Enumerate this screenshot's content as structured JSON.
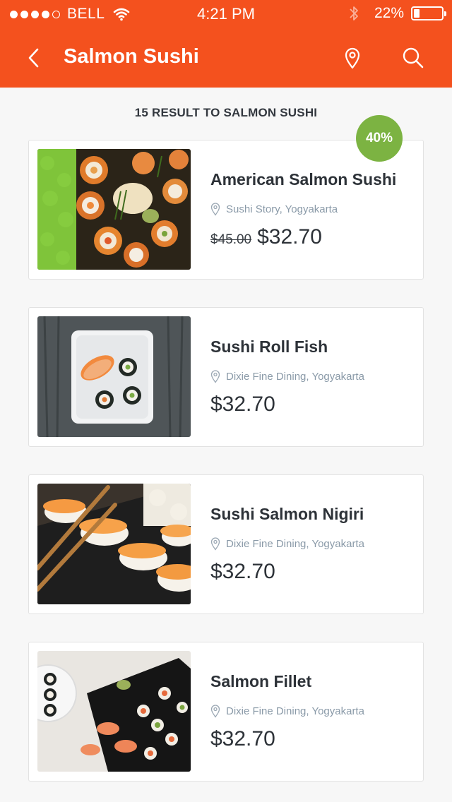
{
  "status_bar": {
    "carrier": "BELL",
    "time": "4:21 PM",
    "battery": "22%",
    "battery_level": 0.22
  },
  "navbar": {
    "title": "Salmon Sushi",
    "back_icon": "chevron-left-icon",
    "location_icon": "map-pin-icon",
    "search_icon": "search-icon"
  },
  "results": {
    "heading": "15 RESULT TO SALMON SUSHI"
  },
  "colors": {
    "brand": "#f4511e",
    "discount": "#7cb342",
    "text": "#2d3238",
    "muted": "#8a9aa8"
  },
  "items": [
    {
      "title": "American Salmon Sushi",
      "location": "Sushi Story, Yogyakarta",
      "old_price": "$45.00",
      "price": "$32.70",
      "discount": "40%"
    },
    {
      "title": "Sushi Roll Fish",
      "location": "Dixie Fine Dining, Yogyakarta",
      "price": "$32.70"
    },
    {
      "title": "Sushi Salmon Nigiri",
      "location": "Dixie Fine Dining, Yogyakarta",
      "price": "$32.70"
    },
    {
      "title": "Salmon Fillet",
      "location": "Dixie Fine Dining, Yogyakarta",
      "price": "$32.70"
    }
  ]
}
